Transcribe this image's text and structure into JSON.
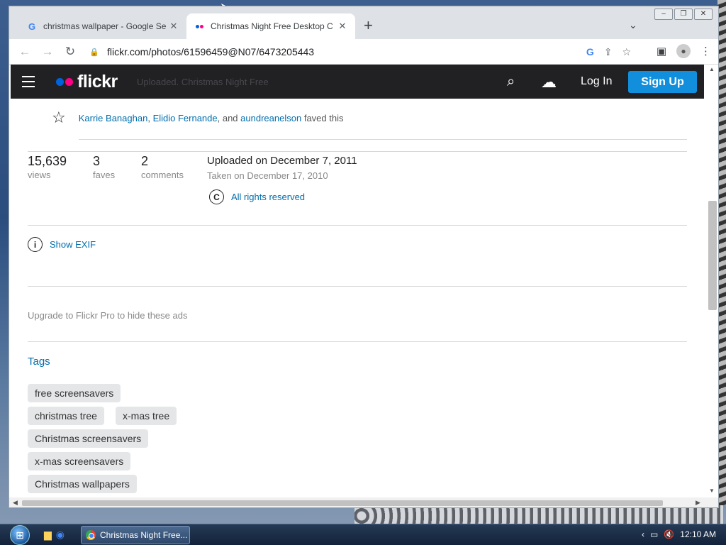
{
  "browser": {
    "tabs": [
      {
        "title": "christmas wallpaper - Google Se",
        "favicon": "google-g",
        "close": "✕"
      },
      {
        "title": "Christmas Night Free Desktop C",
        "favicon": "flickr-dots",
        "close": "✕"
      }
    ],
    "new_tab": "+",
    "tab_search": "⌄",
    "window_controls": {
      "minimize": "–",
      "restore": "❐",
      "close": "✕"
    },
    "url": "flickr.com/photos/61596459@N07/6473205443"
  },
  "flickr": {
    "logo_text": "flickr",
    "ghost_text": "Uploaded. Christmas Night Free",
    "login": "Log In",
    "signup": "Sign Up",
    "brand_colors": {
      "pink": "#ff0084",
      "blue": "#0063dc",
      "header": "#212124",
      "signup": "#128fdc"
    }
  },
  "faves": {
    "names": [
      "Karrie Banaghan",
      "Elidio Fernande",
      "aundreanelson"
    ],
    "sep1": ",",
    "sep2": ", and",
    "suffix": "faved this"
  },
  "stats": [
    {
      "value": "15,639",
      "label": "views"
    },
    {
      "value": "3",
      "label": "faves"
    },
    {
      "value": "2",
      "label": "comments"
    }
  ],
  "photo_info": {
    "uploaded": "Uploaded on December 7, 2011",
    "taken": "Taken on December 17, 2010",
    "rights": "All rights reserved",
    "rights_icon": "C"
  },
  "exif": {
    "label": "Show EXIF",
    "icon": "i"
  },
  "upgrade_text": "Upgrade to Flickr Pro to hide these ads",
  "tags": {
    "title": "Tags",
    "items": [
      "free screensavers",
      "christmas tree",
      "x-mas tree",
      "Christmas screensavers",
      "x-mas screensavers",
      "Christmas wallpapers"
    ]
  },
  "taskbar": {
    "task_label": "Christmas Night Free...",
    "clock": "12:10 AM"
  }
}
